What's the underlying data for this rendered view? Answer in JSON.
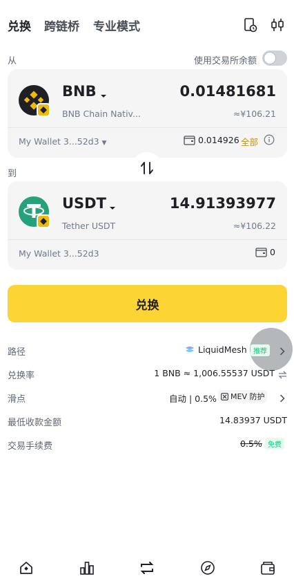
{
  "tabs": [
    "兑换",
    "跨链桥",
    "专业模式"
  ],
  "from_label": "从",
  "use_exchange_balance_label": "使用交易所余额",
  "from_card": {
    "token": "BNB",
    "token_desc": "BNB Chain Nativ...",
    "amount": "0.01481681",
    "fiat": "≈¥106.21",
    "wallet": "My Wallet 3...52d3",
    "balance": "0.014926",
    "max_label": "全部"
  },
  "to_label": "到",
  "to_card": {
    "token": "USDT",
    "token_desc": "Tether USDT",
    "amount": "14.91393977",
    "fiat": "≈¥106.22",
    "wallet": "My Wallet 3...52d3",
    "balance": "0"
  },
  "swap_button": "兑换",
  "details": {
    "route_label": "路径",
    "route_value": "LiquidMesh",
    "route_badge": "推荐",
    "rate_label": "兑换率",
    "rate_value": "1 BNB ≈ 1,006.55537 USDT",
    "slippage_label": "滑点",
    "slippage_value": "自动 | 0.5%",
    "mev_label": "MEV 防护",
    "min_received_label": "最低收款金额",
    "min_received_value": "14.83937 USDT",
    "fee_label": "交易手续费",
    "fee_value": "0.5%",
    "fee_badge": "免费"
  },
  "colors": {
    "accent": "#fcd535",
    "free_green": "#0ecb81",
    "gold_text": "#c99400"
  },
  "icons": [
    "history-icon",
    "settings-icon",
    "bnb-logo",
    "usdt-logo",
    "swap-direction-icon",
    "home-icon",
    "markets-icon",
    "trade-icon",
    "discover-icon",
    "wallet-icon"
  ]
}
